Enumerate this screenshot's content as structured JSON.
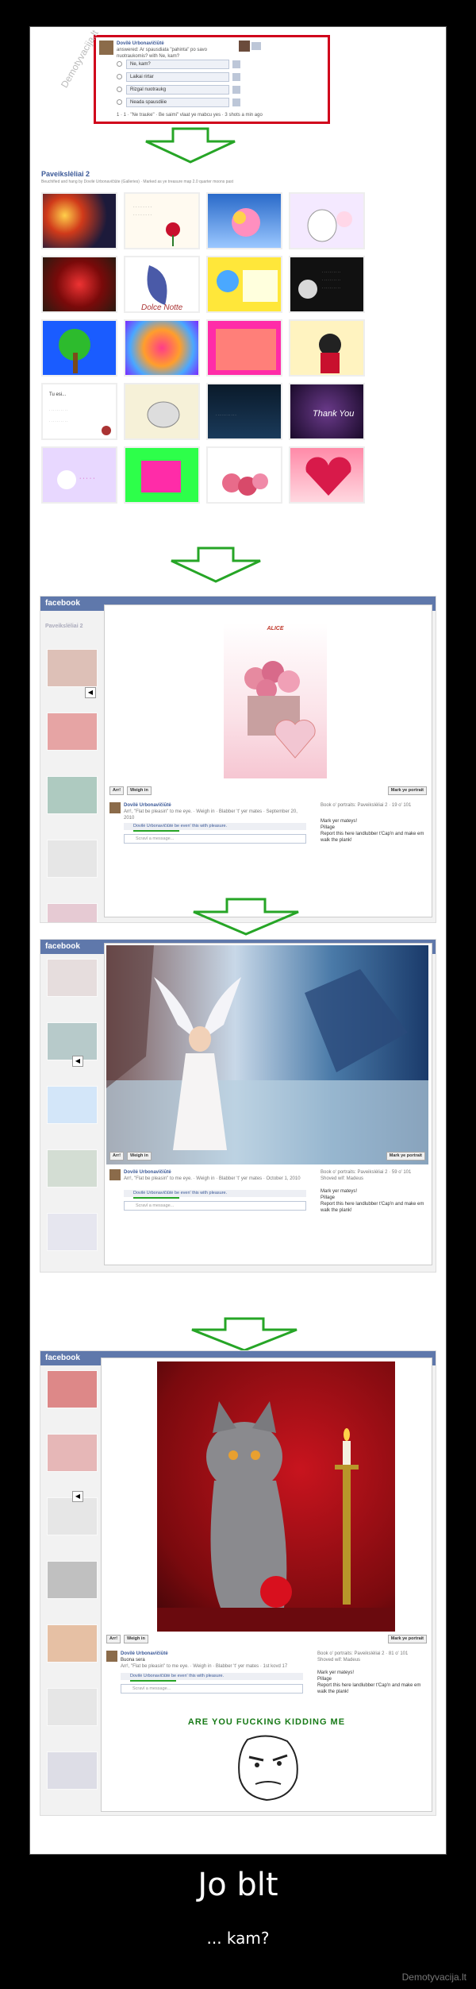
{
  "watermark": "Demotyvacija.lt",
  "poll": {
    "header_name": "Dovilė Urbonavičiūtė",
    "header_text": "answered: Ar spausdiata \"pahinta\" po savo nuotraukomis? with Ne, kam?",
    "options": [
      "Ne, kam?",
      "Laikai rirtar",
      "Rizgal nuotraukg",
      "Neada spausdiiie"
    ],
    "footer": "1 · 1 · \"Ne trauke\" · Be saimi\" vlaat ye mabcu yes · 3 shots a min ago"
  },
  "gallery": {
    "title": "Paveikslėliai 2",
    "subtitle": "Beuchified and hang by Dovilė Urbonavičiūte (Galleries) · Marked as ye treasure map 2.0 quarter moons past"
  },
  "screens": [
    {
      "logo": "facebook",
      "side_title": "Paveikslėliai 2",
      "image_caption": "ALICE",
      "btn_left_1": "Arr!",
      "btn_left_2": "Weigh in",
      "btn_right": "Mark ye portrait",
      "author": "Dovilė Urbonavičiūtė",
      "comment_meta": "Arr!, \"Flat be pleasin\" to me eye. · Weigh in · Blabber 't' yer mates · September 20, 2010",
      "like_text": "Dovilė Urbonavičiūtė be even' this with pleasure.",
      "write_placeholder": "Scravl a message...",
      "right_1": "Book o' portraits: Paveikslėliai 2 · 19 o' 101",
      "right_2": "Mark yer mateys!",
      "right_3": "Pillage",
      "right_4": "Report this here landlubber t'Cap'n and make em walk the plank!"
    },
    {
      "logo": "facebook",
      "btn_left_1": "Arr!",
      "btn_left_2": "Weigh in",
      "btn_right": "Mark ye portrait",
      "author": "Dovilė Urbonavičiūtė",
      "comment_meta": "Arr!, \"Flat be pleasin\" to me eye. · Weigh in · Blabber 't' yer mates · October 1, 2010",
      "like_text": "Dovilė Urbonavičiūtė be even' this with pleasure.",
      "write_placeholder": "Scravl a message...",
      "right_1": "Book o' portraits: Paveikslėliai 2 · 59 o' 101",
      "right_1b": "Shoved wif: Madeus",
      "right_2": "Mark yer mateys!",
      "right_3": "Pillage",
      "right_4": "Report this here landlubber t'Cap'n and make em walk the plank!"
    },
    {
      "logo": "facebook",
      "btn_left_1": "Arr!",
      "btn_left_2": "Weigh in",
      "btn_right": "Mark ye portrait",
      "author": "Dovilė Urbonavičiūtė",
      "author_sub": "Buona sera",
      "comment_meta": "Arr!, \"Flat be pleasin\" to me eye. · Weigh in · Blabber 't' yer mates · 1st kovd 17",
      "like_text": "Dovilė Urbonavičiūtė be even' this with pleasure.",
      "write_placeholder": "Scravl a message...",
      "right_1": "Book o' portraits: Paveikslėliai 2 · 81 o' 101",
      "right_1b": "Shoved wif: Madeus",
      "right_2": "Mark yer mateys!",
      "right_3": "Pillage",
      "right_4": "Report this here landlubber t'Cap'n and make em walk the plank!"
    }
  ],
  "meme_text": "ARE YOU FUCKING KIDDING ME",
  "caption": {
    "title": "Jo blt",
    "subtitle": "... kam?"
  },
  "colors": {
    "fb_blue": "#3b5998",
    "highlight_red": "#d0021b",
    "arrow_green": "#26a526"
  }
}
